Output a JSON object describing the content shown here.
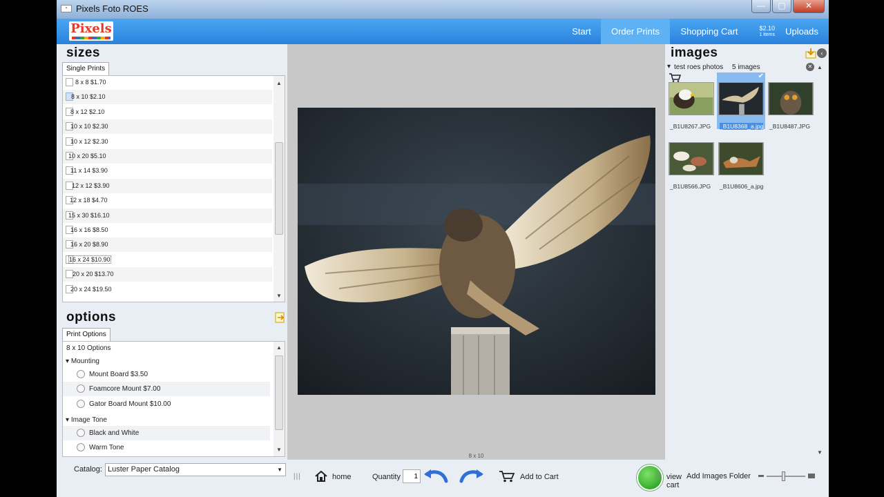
{
  "window": {
    "title": "Pixels Foto ROES",
    "controls": {
      "minimize": "—",
      "maximize": "▢",
      "close": "✕"
    }
  },
  "logo": {
    "text": "Pixels"
  },
  "nav": {
    "items": [
      {
        "label": "Start",
        "active": false
      },
      {
        "label": "Order Prints",
        "active": true
      },
      {
        "label": "Shopping Cart",
        "active": false
      },
      {
        "label": "Uploads",
        "active": false
      }
    ],
    "cart_total": "$2.10",
    "cart_items": "1 items"
  },
  "sizes": {
    "title": "sizes",
    "tab": "Single Prints",
    "items": [
      {
        "label": "8 x 8 $1.70",
        "selected": false
      },
      {
        "label": "8 x 10 $2.10",
        "selected": true
      },
      {
        "label": "8 x 12 $2.10",
        "selected": false
      },
      {
        "label": "10 x 10 $2.30",
        "selected": false
      },
      {
        "label": "10 x 12 $2.30",
        "selected": false
      },
      {
        "label": "10 x 20 $5.10",
        "selected": false
      },
      {
        "label": "11 x 14 $3.90",
        "selected": false
      },
      {
        "label": "12 x 12 $3.90",
        "selected": false
      },
      {
        "label": "12 x 18 $4.70",
        "selected": false
      },
      {
        "label": "15 x 30 $16.10",
        "selected": false
      },
      {
        "label": "16 x 16 $8.50",
        "selected": false
      },
      {
        "label": "16 x 20 $8.90",
        "selected": false
      },
      {
        "label": "16 x 24 $10.90",
        "selected": false
      },
      {
        "label": "20 x 20 $13.70",
        "selected": false
      },
      {
        "label": "20 x 24 $19.50",
        "selected": false
      }
    ]
  },
  "options": {
    "title": "options",
    "tab": "Print Options",
    "header": "8 x 10 Options",
    "groups": [
      {
        "name": "Mounting",
        "items": [
          "Mount Board $3.50",
          "Foamcore Mount  $7.00",
          "Gator Board Mount $10.00"
        ]
      },
      {
        "name": "Image Tone",
        "items": [
          "Black and White",
          "Warm Tone"
        ]
      }
    ]
  },
  "catalog": {
    "label": "Catalog:",
    "value": "Luster Paper Catalog"
  },
  "preview": {
    "size_caption": "8 x 10"
  },
  "toolbar": {
    "home": "home",
    "quantity_label": "Quantity",
    "quantity": "1",
    "add_to_cart": "Add to Cart",
    "view_cart": "view cart",
    "add_folder": "Add Images Folder"
  },
  "images": {
    "title": "images",
    "folder": "test roes photos",
    "count": "5 images",
    "files": [
      {
        "name": "_B1U8267.JPG",
        "selected": false
      },
      {
        "name": "_B1U8368_a.jpg",
        "selected": true
      },
      {
        "name": "_B1U8487.JPG",
        "selected": false
      },
      {
        "name": "_B1U8566.JPG",
        "selected": false
      },
      {
        "name": "_B1U8606_a.jpg",
        "selected": false
      }
    ]
  },
  "colors": {
    "nav_blue": "#2a82dc",
    "nav_active": "#5eb2f4",
    "selection": "#4a8ee0",
    "cart_green": "#3fb535"
  }
}
